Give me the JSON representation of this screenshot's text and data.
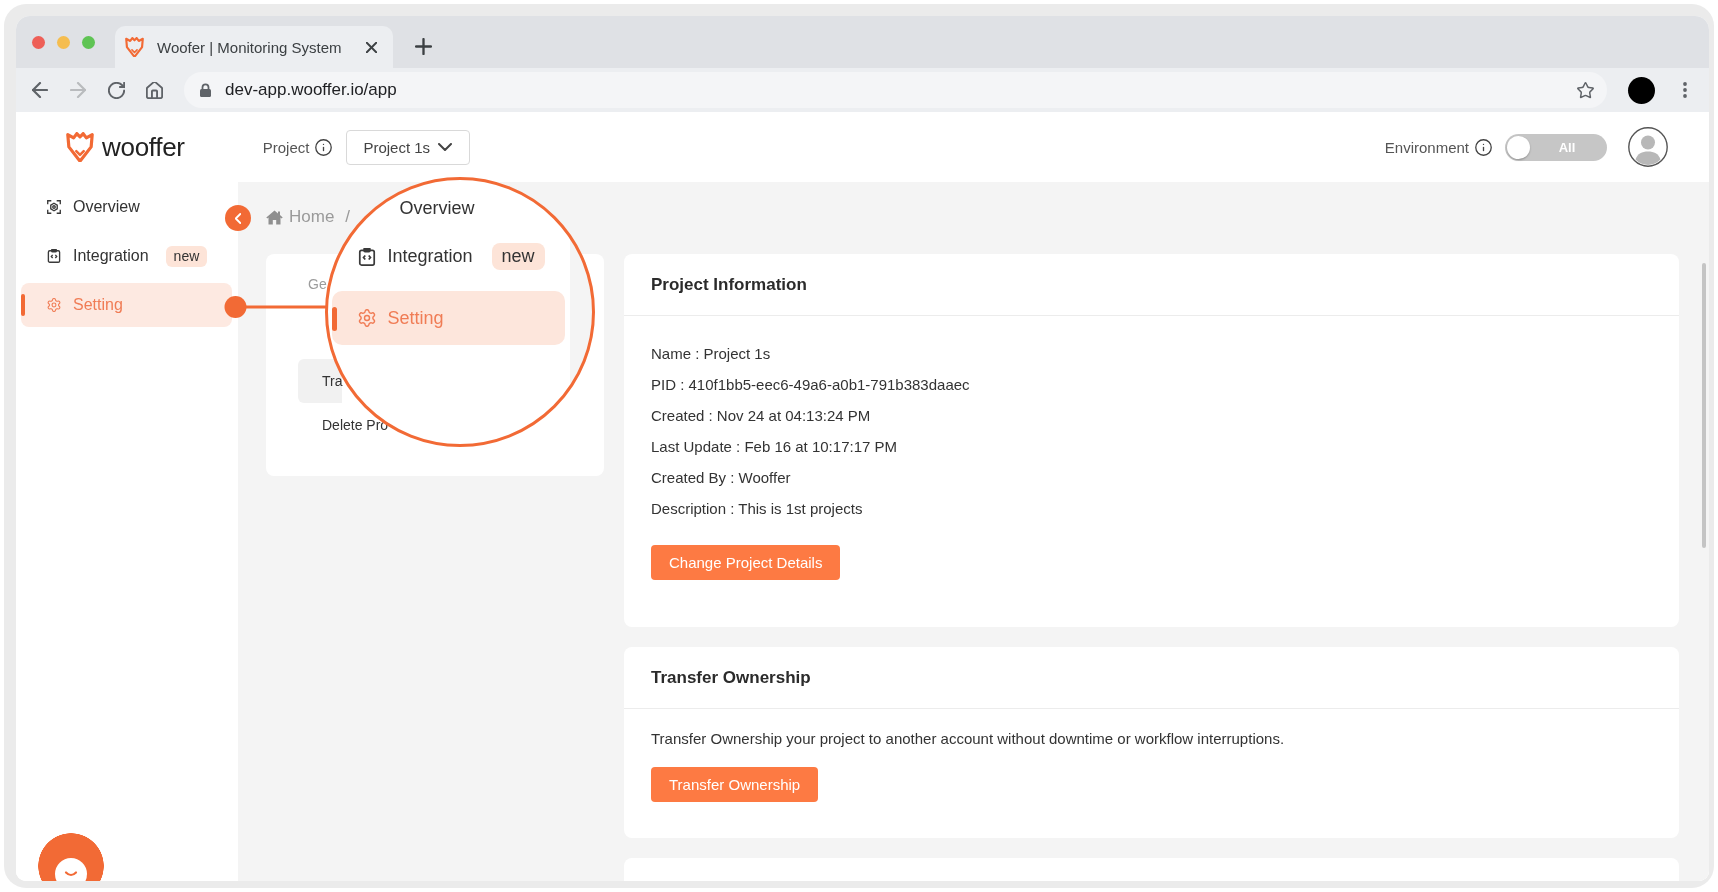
{
  "browser": {
    "tab": {
      "title": "Woofer | Monitoring System",
      "selected": true
    },
    "back_button": {
      "disabled": false
    },
    "forward_button": {
      "disabled": true
    },
    "url": "dev-app.wooffer.io/app"
  },
  "header": {
    "logo": "wooffer",
    "project_label": "Project",
    "project_select": "Project 1s",
    "environment_label": "Environment",
    "environment_toggle": {
      "on": false,
      "label": "All"
    }
  },
  "sidebar": {
    "items": [
      {
        "label": "Overview",
        "kind": "overview",
        "selected": false
      },
      {
        "label": "Integration",
        "kind": "integration",
        "badge": "new",
        "selected": false
      },
      {
        "label": "Setting",
        "kind": "setting",
        "selected": true
      }
    ]
  },
  "breadcrumb": {
    "home": "Home",
    "separator": "/"
  },
  "settings_menu": {
    "items": [
      {
        "label": "Ge",
        "kind": "heading"
      },
      {
        "label": "Tra",
        "kind": "item",
        "selected": true
      },
      {
        "label": "Delete Pro",
        "kind": "item",
        "selected": false
      }
    ]
  },
  "magnifier": {
    "items": [
      {
        "label": "Overview",
        "kind": "plain",
        "selected": false
      },
      {
        "label": "Integration",
        "kind": "integration",
        "badge": "new",
        "selected": false
      },
      {
        "label": "Setting",
        "kind": "setting",
        "selected": true
      }
    ]
  },
  "project_information": {
    "title": "Project Information",
    "lines": [
      "Name : Project 1s",
      "PID : 410f1bb5-eec6-49a6-a0b1-791b383daaec",
      "Created : Nov 24 at 04:13:24 PM",
      "Last Update : Feb 16 at 10:17:17 PM",
      "Created By : Wooffer",
      "Description : This is 1st projects"
    ],
    "button": "Change Project Details"
  },
  "transfer_ownership": {
    "title": "Transfer Ownership",
    "description": "Transfer Ownership your project to another account without downtime or workflow interruptions.",
    "button": "Transfer Ownership"
  }
}
